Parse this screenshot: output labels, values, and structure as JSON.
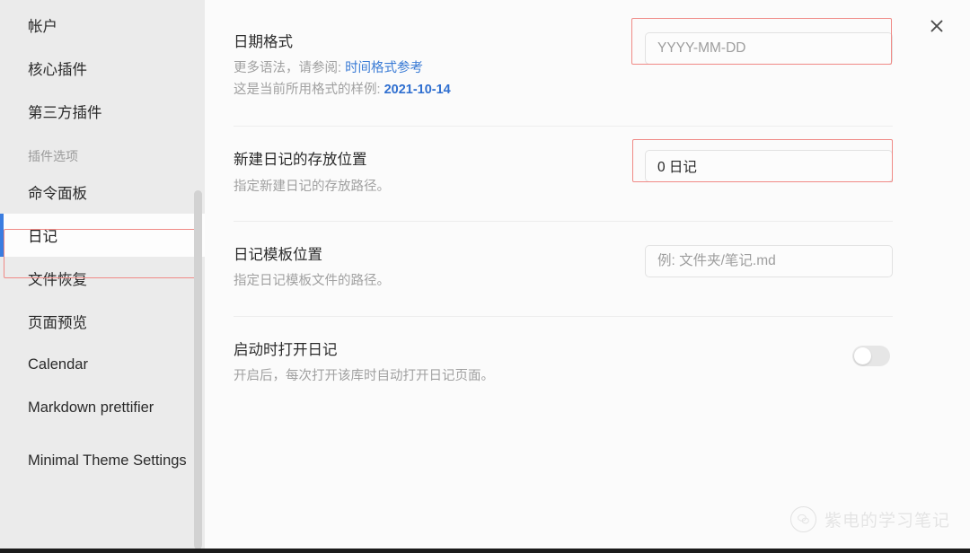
{
  "sidebar": {
    "top_items": [
      {
        "label": "帐户",
        "name": "sidebar-item-account"
      },
      {
        "label": "核心插件",
        "name": "sidebar-item-core-plugins"
      },
      {
        "label": "第三方插件",
        "name": "sidebar-item-community-plugins"
      }
    ],
    "section_label": "插件选项",
    "plugin_items": [
      {
        "label": "命令面板",
        "name": "sidebar-item-command-palette",
        "active": false
      },
      {
        "label": "日记",
        "name": "sidebar-item-daily-notes",
        "active": true
      },
      {
        "label": "文件恢复",
        "name": "sidebar-item-file-recovery",
        "active": false
      },
      {
        "label": "页面预览",
        "name": "sidebar-item-page-preview",
        "active": false
      },
      {
        "label": "Calendar",
        "name": "sidebar-item-calendar",
        "active": false
      },
      {
        "label": "Markdown prettifier",
        "name": "sidebar-item-markdown-prettifier",
        "active": false
      },
      {
        "label": "Minimal Theme Settings",
        "name": "sidebar-item-minimal-theme-settings",
        "active": false
      }
    ]
  },
  "header": {
    "close_icon": "close-icon"
  },
  "settings": {
    "date_format": {
      "title": "日期格式",
      "desc_prefix": "更多语法，请参阅: ",
      "desc_link": "时间格式参考",
      "sample_prefix": "这是当前所用格式的样例: ",
      "sample_value": "2021-10-14",
      "input_value": "",
      "input_placeholder": "YYYY-MM-DD"
    },
    "new_file_location": {
      "title": "新建日记的存放位置",
      "desc": "指定新建日记的存放路径。",
      "input_value": "0 日记",
      "input_placeholder": ""
    },
    "template_location": {
      "title": "日记模板位置",
      "desc": "指定日记模板文件的路径。",
      "input_value": "",
      "input_placeholder": "例: 文件夹/笔记.md"
    },
    "open_on_startup": {
      "title": "启动时打开日记",
      "desc": "开启后，每次打开该库时自动打开日记页面。",
      "toggle_state": "off"
    }
  },
  "watermark": {
    "logo_icon": "wechat-logo-icon",
    "text": "紫电的学习笔记"
  },
  "colors": {
    "accent_blue": "#3b7de0",
    "link_blue": "#3a7bd5",
    "annotation_red": "#f08a86",
    "sidebar_bg": "#ebebeb",
    "content_bg": "#fbfbfb"
  }
}
